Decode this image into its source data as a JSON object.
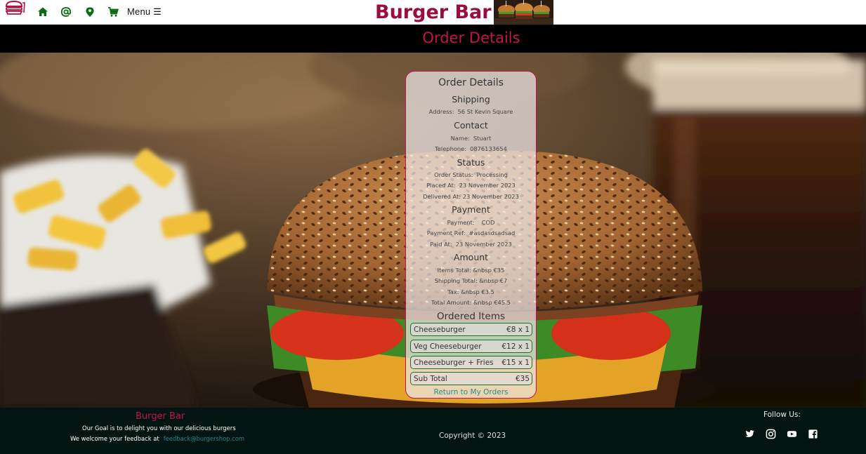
{
  "nav": {
    "menu_label": "Menu ☰",
    "brand": "Burger Bar",
    "icons": [
      "burger-logo-icon",
      "home-icon",
      "at-icon",
      "location-pin-icon",
      "cart-icon",
      "hamburger-menu-icon"
    ]
  },
  "page_title": "Order Details",
  "card": {
    "title": "Order Details",
    "shipping": {
      "heading": "Shipping",
      "address_label": "Address:",
      "address": "56 St Kevin Square"
    },
    "contact": {
      "heading": "Contact",
      "name_label": "Name:",
      "name": "Stuart",
      "phone_label": "Telephone:",
      "phone": "0876133654"
    },
    "status": {
      "heading": "Status",
      "order_status_label": "Order Status:",
      "order_status": "Processing",
      "placed_label": "Placed At:",
      "placed": "23 November 2023",
      "delivered_label": "Delivered At:",
      "delivered": "23 November 2023"
    },
    "payment": {
      "heading": "Payment",
      "method_label": "Payment:",
      "method": "COD",
      "ref_label": "Payment Ref:",
      "ref": "#asdasdsadsad",
      "paid_label": "Paid At:",
      "paid": "23 November 2023"
    },
    "amount": {
      "heading": "Amount",
      "items_total": "Items Total: &nbsp €35",
      "shipping_total": "Shipping Total: &nbsp €7",
      "tax": "Tax: &nbsp €3.5",
      "total": "Total Amount: &nbsp €45.5"
    },
    "ordered_items": {
      "heading": "Ordered Items",
      "items": [
        {
          "name": "Cheeseburger",
          "price": "€8 x 1"
        },
        {
          "name": "Veg Cheeseburger",
          "price": "€12 x 1"
        },
        {
          "name": "Cheeseburger + Fries",
          "price": "€15 x 1"
        }
      ],
      "subtotal_label": "Sub Total",
      "subtotal": "€35"
    },
    "return_link": "Return to My Orders"
  },
  "footer": {
    "brand": "Burger Bar",
    "goal": "Our Goal is to delight you with our delicious burgers",
    "feedback_prefix": "We welcome your feedback at",
    "feedback_email": "feedback@burgershop.com",
    "copyright": "Copyright © 2023",
    "follow": "Follow Us:",
    "social_icons": [
      "twitter-icon",
      "instagram-icon",
      "youtube-icon",
      "facebook-icon"
    ]
  },
  "colors": {
    "brand": "#9b0d3e",
    "accent": "#c4124e",
    "link": "#2a8e8a",
    "item_border": "#1e6e2a",
    "footer_bg": "#031513",
    "nav_icon": "#0b6b12"
  }
}
